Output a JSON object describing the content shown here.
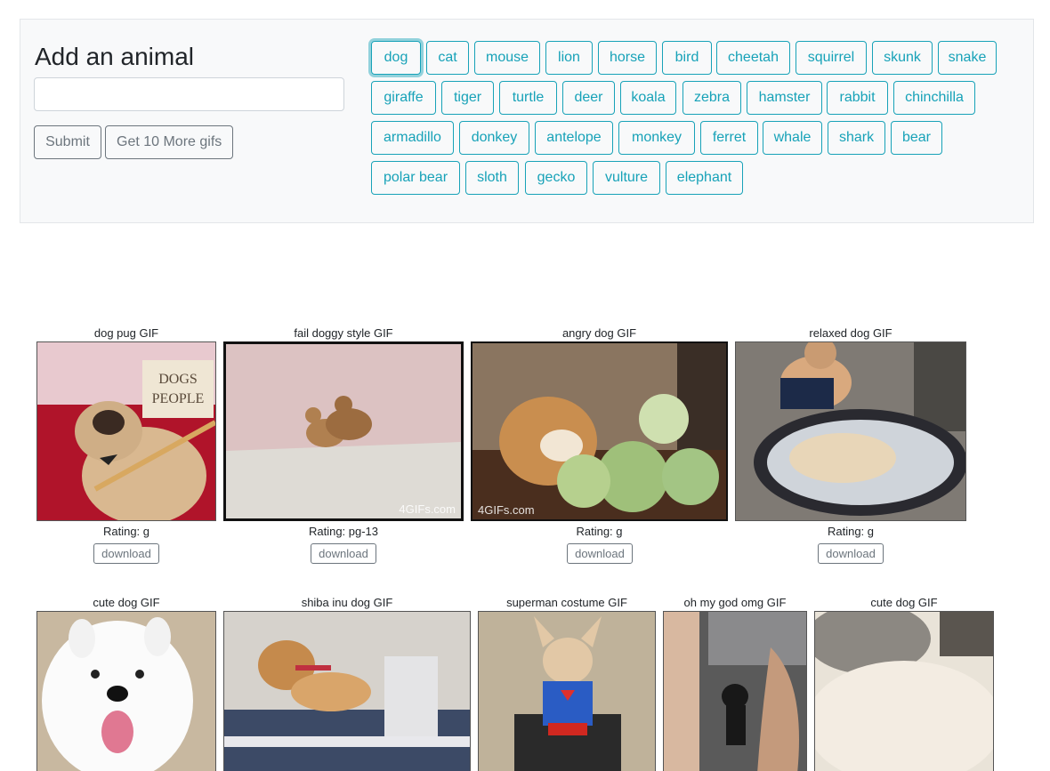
{
  "form": {
    "title": "Add an animal",
    "input_value": "",
    "submit_label": "Submit",
    "more_label": "Get 10 More gifs"
  },
  "animals": [
    "dog",
    "cat",
    "mouse",
    "lion",
    "horse",
    "bird",
    "cheetah",
    "squirrel",
    "skunk",
    "snake",
    "giraffe",
    "tiger",
    "turtle",
    "deer",
    "koala",
    "zebra",
    "hamster",
    "rabbit",
    "chinchilla",
    "armadillo",
    "donkey",
    "antelope",
    "monkey",
    "ferret",
    "whale",
    "shark",
    "bear",
    "polar bear",
    "sloth",
    "gecko",
    "vulture",
    "elephant"
  ],
  "selected_animal": "dog",
  "colors": {
    "accent": "#17a2b8",
    "secondary": "#6c757d",
    "panel_bg": "#f8f9fa"
  },
  "gifs": [
    {
      "title": "dog pug GIF",
      "rating": "Rating: g",
      "download": "download"
    },
    {
      "title": "fail doggy style GIF",
      "rating": "Rating: pg-13",
      "download": "download",
      "watermark": "4GIFs.com"
    },
    {
      "title": "angry dog GIF",
      "rating": "Rating: g",
      "download": "download",
      "watermark": "4GIFs.com"
    },
    {
      "title": "relaxed dog GIF",
      "rating": "Rating: g",
      "download": "download"
    },
    {
      "title": "cute dog GIF"
    },
    {
      "title": "shiba inu dog GIF"
    },
    {
      "title": "superman costume GIF"
    },
    {
      "title": "oh my god omg GIF"
    },
    {
      "title": "cute dog GIF"
    }
  ]
}
